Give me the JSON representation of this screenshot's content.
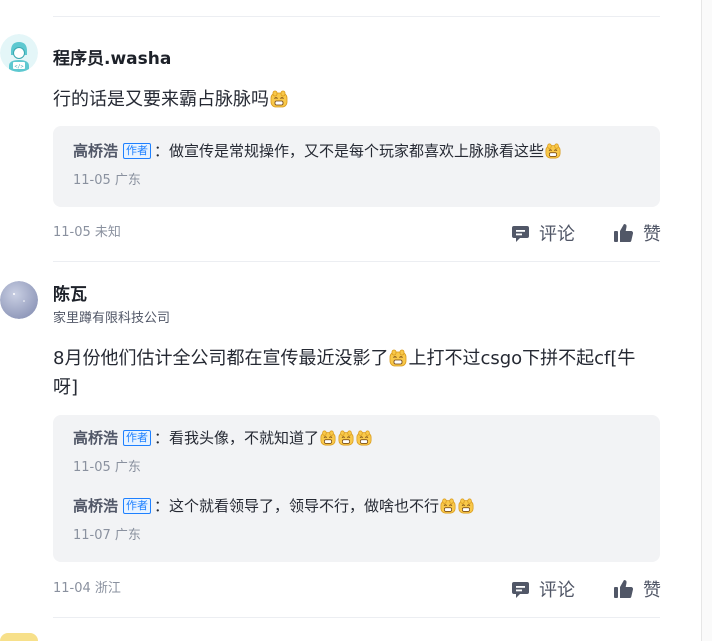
{
  "comments": [
    {
      "username": "程序员.washa",
      "content_before": "行的话是又要来霸占脉脉吗",
      "content_after": "",
      "replies": [
        {
          "author": "高桥浩",
          "tag": "作者",
          "text": "：做宣传是常规操作，又不是每个玩家都喜欢上脉脉看这些",
          "emoji_count": 1,
          "date": "11-05",
          "location": "广东"
        }
      ],
      "date": "11-05",
      "location": "未知",
      "comment_label": "评论",
      "like_label": "赞"
    },
    {
      "username": "陈瓦",
      "title": "家里蹲有限科技公司",
      "content_before": "8月份他们估计全公司都在宣传最近没影了",
      "content_after": "上打不过csgo下拼不起cf[牛呀]",
      "replies": [
        {
          "author": "高桥浩",
          "tag": "作者",
          "text": "：看我头像，不就知道了",
          "emoji_count": 3,
          "date": "11-05",
          "location": "广东"
        },
        {
          "author": "高桥浩",
          "tag": "作者",
          "text": "：这个就看领导了，领导不行，做啥也不行",
          "emoji_count": 2,
          "date": "11-07",
          "location": "广东"
        }
      ],
      "date": "11-04",
      "location": "浙江",
      "comment_label": "评论",
      "like_label": "赞"
    }
  ],
  "colors": {
    "author_tag": "#1e80ff",
    "reply_bg": "#f2f3f5",
    "meta": "#8a919f"
  },
  "icons": {
    "comment": "comment-icon",
    "like": "thumbs-up-icon",
    "emoji": "grin-emoji-icon"
  }
}
